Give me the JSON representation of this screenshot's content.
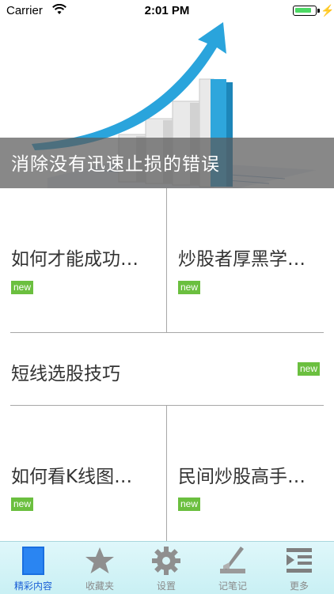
{
  "status_bar": {
    "carrier": "Carrier",
    "time": "2:01 PM"
  },
  "banner": {
    "caption": "消除没有迅速止损的错误"
  },
  "items": [
    {
      "title": "如何才能成功…",
      "badge": "new"
    },
    {
      "title": "炒股者厚黑学…",
      "badge": "new"
    },
    {
      "title": "短线选股技巧",
      "badge": "new"
    },
    {
      "title": "如何看K线图…",
      "badge": "new"
    },
    {
      "title": "民间炒股高手…",
      "badge": "new"
    }
  ],
  "tabs": [
    {
      "label": "精彩内容",
      "icon": "document-icon",
      "active": true
    },
    {
      "label": "收藏夹",
      "icon": "star-icon",
      "active": false
    },
    {
      "label": "设置",
      "icon": "gear-icon",
      "active": false
    },
    {
      "label": "记笔记",
      "icon": "pencil-icon",
      "active": false
    },
    {
      "label": "更多",
      "icon": "list-icon",
      "active": false
    }
  ],
  "colors": {
    "badge": "#6bbf3f",
    "tab_active": "#1a5fd6",
    "tabbar_bg": "#d8f4f7"
  }
}
